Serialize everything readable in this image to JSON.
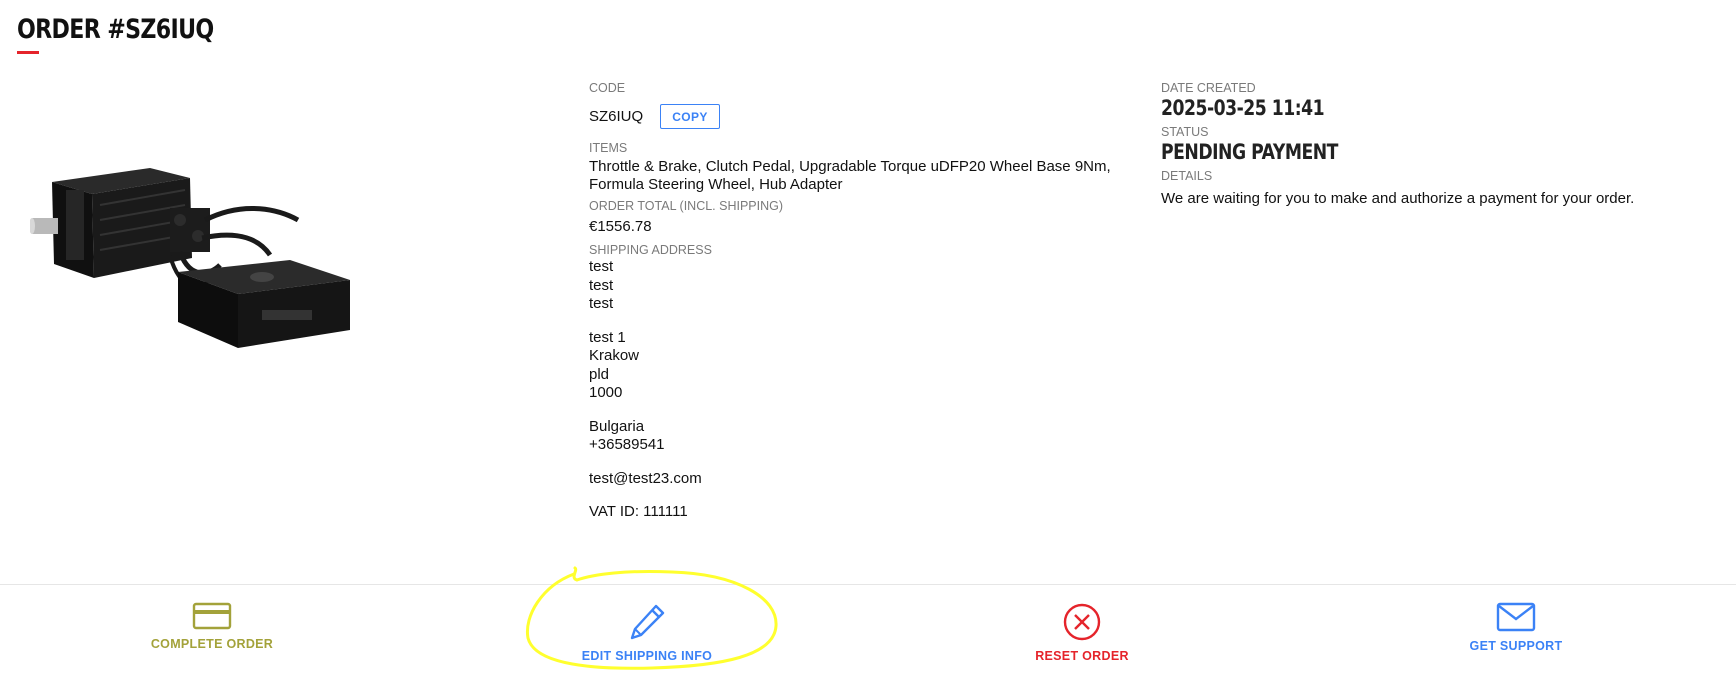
{
  "header": {
    "order_title": "ORDER #SZ6IUQ"
  },
  "details": {
    "code_label": "CODE",
    "code_value": "SZ6IUQ",
    "copy_label": "COPY",
    "items_label": "ITEMS",
    "items_value": "Throttle & Brake, Clutch Pedal, Upgradable Torque uDFP20 Wheel Base 9Nm, Formula Steering Wheel, Hub Adapter",
    "total_label": "ORDER TOTAL (INCL. SHIPPING)",
    "total_value": "€1556.78",
    "shipping_label": "SHIPPING ADDRESS",
    "address": {
      "name_lines": [
        "test",
        "test",
        "test"
      ],
      "street_lines": [
        "test 1",
        "Krakow",
        "pld",
        "1000"
      ],
      "country": "Bulgaria",
      "phone": "+36589541",
      "email": "test@test23.com",
      "vat": "VAT ID: 111111"
    }
  },
  "status_panel": {
    "date_label": "DATE CREATED",
    "date_value": "2025-03-25 11:41",
    "status_label": "STATUS",
    "status_value": "PENDING PAYMENT",
    "details_label": "DETAILS",
    "details_value": "We are waiting for you to make and authorize a payment for your order."
  },
  "actions": {
    "complete_label": "COMPLETE ORDER",
    "edit_label": "EDIT SHIPPING INFO",
    "reset_label": "RESET ORDER",
    "support_label": "GET SUPPORT"
  },
  "icons": {
    "complete": "credit-card-icon",
    "edit": "pencil-icon",
    "reset": "close-circle-icon",
    "support": "envelope-icon"
  },
  "colors": {
    "title_accent": "#e5242b",
    "complete": "#a3a23a",
    "edit": "#3b82f6",
    "reset": "#e5242b",
    "support": "#3b82f6",
    "highlight": "#ffff2e"
  }
}
